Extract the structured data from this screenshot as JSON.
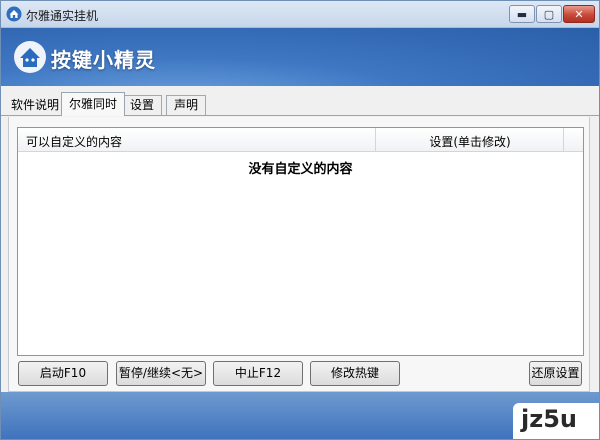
{
  "window": {
    "title": "尔雅通实挂机",
    "controls": {
      "minimize": "▬",
      "maximize": "▢",
      "close": "✕"
    }
  },
  "banner": {
    "logo_icon": "house-logo-icon",
    "title": "按键小精灵",
    "accent": "#3f77c3"
  },
  "tabs": [
    {
      "label": "软件说明",
      "active": false
    },
    {
      "label": "尔雅同时",
      "active": true
    },
    {
      "label": "设置",
      "active": false
    },
    {
      "label": "声明",
      "active": false
    }
  ],
  "list": {
    "columns": [
      "可以自定义的内容",
      "设置(单击修改)"
    ],
    "empty_message": "没有自定义的内容"
  },
  "buttons": {
    "start": "启动F10",
    "pause": "暂停/继续<无>",
    "stop": "中止F12",
    "hotkey": "修改热键",
    "restore": "还原设置"
  },
  "watermark": {
    "text": "jz5u"
  }
}
